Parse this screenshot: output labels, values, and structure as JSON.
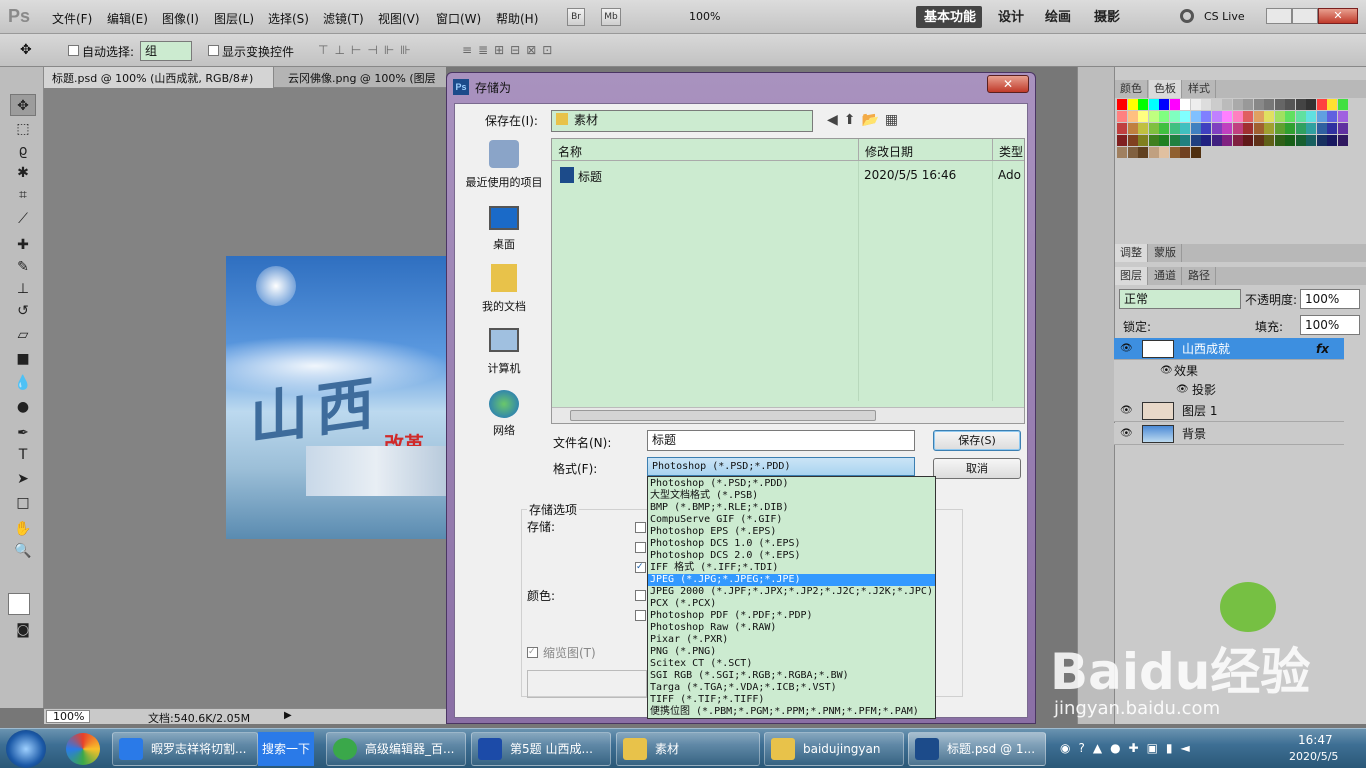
{
  "app": {
    "logo": "Ps",
    "menu": [
      "文件(F)",
      "编辑(E)",
      "图像(I)",
      "图层(L)",
      "选择(S)",
      "滤镜(T)",
      "视图(V)",
      "窗口(W)",
      "帮助(H)"
    ],
    "bridge": "Br",
    "minibridge": "Mb",
    "zoom": "100%",
    "workspaces": {
      "active": "基本功能",
      "others": [
        "设计",
        "绘画",
        "摄影"
      ]
    },
    "cslive": "CS Live"
  },
  "options": {
    "auto_select": "自动选择:",
    "auto_select_value": "组",
    "show_transform": "显示变换控件"
  },
  "docs": {
    "tab1": "标题.psd @ 100% (山西成就, RGB/8#)",
    "tab2": "云冈佛像.png @ 100% (图层"
  },
  "canvas": {
    "title_text": "山西",
    "subtitle": "改革"
  },
  "status": {
    "zoom": "100%",
    "doc": "文档:540.6K/2.05M"
  },
  "panels": {
    "swatch_tabs": [
      "颜色",
      "色板",
      "样式"
    ],
    "adj_tabs": [
      "调整",
      "蒙版"
    ],
    "layer_tabs": [
      "图层",
      "通道",
      "路径"
    ],
    "blend": "正常",
    "opacity_label": "不透明度:",
    "opacity": "100%",
    "lock_label": "锁定:",
    "fill_label": "填充:",
    "fill": "100%",
    "layers": [
      {
        "name": "山西成就",
        "fx": "fx"
      },
      {
        "name": "效果"
      },
      {
        "name": "投影"
      },
      {
        "name": "图层 1"
      },
      {
        "name": "背景"
      }
    ]
  },
  "dialog": {
    "title": "存储为",
    "save_in_label": "保存在(I):",
    "save_in": "素材",
    "places": [
      "最近使用的项目",
      "桌面",
      "我的文档",
      "计算机",
      "网络"
    ],
    "columns": [
      "名称",
      "修改日期",
      "类型"
    ],
    "file": {
      "name": "标题",
      "date": "2020/5/5 16:46",
      "type": "Ado"
    },
    "filename_label": "文件名(N):",
    "filename": "标题",
    "format_label": "格式(F):",
    "format": "Photoshop (*.PSD;*.PDD)",
    "save": "保存(S)",
    "cancel": "取消",
    "options_title": "存储选项",
    "store_label": "存储:",
    "color_label": "颜色:",
    "thumbnail": "缩览图(T)",
    "formats": [
      "Photoshop (*.PSD;*.PDD)",
      "大型文档格式 (*.PSB)",
      "BMP (*.BMP;*.RLE;*.DIB)",
      "CompuServe GIF (*.GIF)",
      "Photoshop EPS (*.EPS)",
      "Photoshop DCS 1.0 (*.EPS)",
      "Photoshop DCS 2.0 (*.EPS)",
      "IFF 格式 (*.IFF;*.TDI)",
      "JPEG (*.JPG;*.JPEG;*.JPE)",
      "JPEG 2000 (*.JPF;*.JPX;*.JP2;*.J2C;*.J2K;*.JPC)",
      "PCX (*.PCX)",
      "Photoshop PDF (*.PDF;*.PDP)",
      "Photoshop Raw (*.RAW)",
      "Pixar (*.PXR)",
      "PNG (*.PNG)",
      "Scitex CT (*.SCT)",
      "SGI RGB (*.SGI;*.RGB;*.RGBA;*.BW)",
      "Targa (*.TGA;*.VDA;*.ICB;*.VST)",
      "TIFF (*.TIF;*.TIFF)",
      "便携位图 (*.PBM;*.PGM;*.PPM;*.PNM;*.PFM;*.PAM)"
    ],
    "selected_format_index": 8
  },
  "watermark": {
    "brand": "Baidu经验",
    "url": "jingyan.baidu.com"
  },
  "taskbar": {
    "items": [
      "暇罗志祥将切割...",
      "搜索一下",
      "高级编辑器_百...",
      "第5题 山西成...",
      "素材",
      "baidujingyan",
      "标题.psd @ 1..."
    ],
    "time": "16:47",
    "date": "2020/5/5"
  },
  "colors": {
    "sel": "#3399ff",
    "list_bg": "#ccebd0"
  }
}
